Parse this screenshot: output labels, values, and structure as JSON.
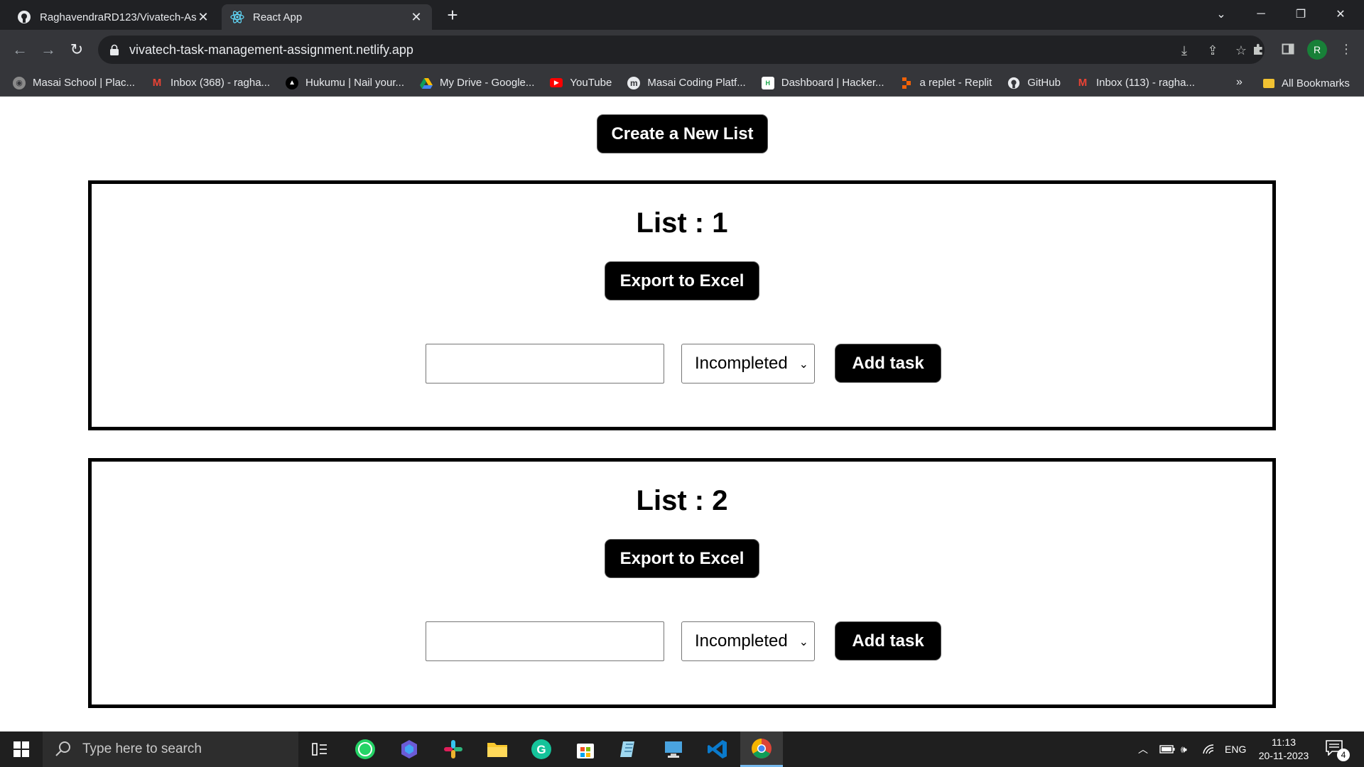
{
  "browser": {
    "tabs": [
      {
        "title": "RaghavendraRD123/Vivatech-As",
        "icon": "github-icon",
        "active": false
      },
      {
        "title": "React App",
        "icon": "react-icon",
        "active": true
      }
    ],
    "url": "vivatech-task-management-assignment.netlify.app",
    "profile_initial": "R",
    "bookmarks": [
      {
        "label": "Masai School | Plac...",
        "icon": "masai-icon"
      },
      {
        "label": "Inbox (368) - ragha...",
        "icon": "gmail-icon"
      },
      {
        "label": "Hukumu | Nail your...",
        "icon": "hukumu-icon"
      },
      {
        "label": "My Drive - Google...",
        "icon": "drive-icon"
      },
      {
        "label": "YouTube",
        "icon": "youtube-icon"
      },
      {
        "label": "Masai Coding Platf...",
        "icon": "masai-m-icon"
      },
      {
        "label": "Dashboard | Hacker...",
        "icon": "hackerrank-icon"
      },
      {
        "label": "a replet - Replit",
        "icon": "replit-icon"
      },
      {
        "label": "GitHub",
        "icon": "github-icon"
      },
      {
        "label": "Inbox (113) - ragha...",
        "icon": "gmail-icon"
      }
    ],
    "bookmarks_more": "»",
    "all_bookmarks": "All Bookmarks"
  },
  "page": {
    "create_button": "Create a New List",
    "lists": [
      {
        "title": "List : 1",
        "export_label": "Export to Excel",
        "task_value": "",
        "status_selected": "Incompleted",
        "add_label": "Add task"
      },
      {
        "title": "List : 2",
        "export_label": "Export to Excel",
        "task_value": "",
        "status_selected": "Incompleted",
        "add_label": "Add task"
      }
    ]
  },
  "taskbar": {
    "search_placeholder": "Type here to search",
    "language": "ENG",
    "time": "11:13",
    "date": "20-11-2023",
    "notification_count": "4"
  },
  "colors": {
    "button_bg": "#000000",
    "button_text": "#ffffff",
    "chrome_dark": "#202124",
    "chrome_toolbar": "#35363a"
  }
}
